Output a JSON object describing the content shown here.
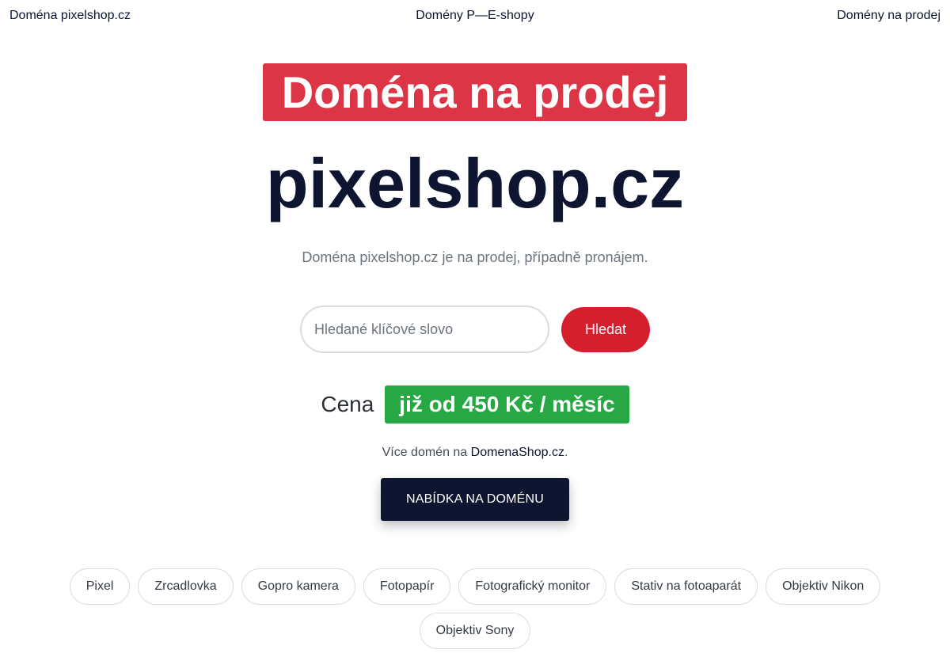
{
  "nav": {
    "left": "Doména pixelshop.cz",
    "center": "Domény P—E-shopy",
    "right": "Domény na prodej"
  },
  "banner": "Doména na prodej",
  "domain": "pixelshop.cz",
  "subtitle": "Doména pixelshop.cz je na prodej, případně pronájem.",
  "search": {
    "placeholder": "Hledané klíčové slovo",
    "value": "",
    "button_label": "Hledat"
  },
  "price": {
    "label": "Cena",
    "badge": "již od 450 Kč / měsíc"
  },
  "more": {
    "prefix": "Více domén na ",
    "link": "DomenaShop.cz",
    "suffix": "."
  },
  "offer_button": "NABÍDKA NA DOMÉNU",
  "tags": [
    "Pixel",
    "Zrcadlovka",
    "Gopro kamera",
    "Fotopapír",
    "Fotografický monitor",
    "Stativ na fotoaparát",
    "Objektiv Nikon",
    "Objektiv Sony"
  ],
  "colors": {
    "banner_bg": "#dc3545",
    "search_button_bg": "#d61f2c",
    "price_badge_bg": "#28a745",
    "primary_dark": "#0d1530"
  }
}
